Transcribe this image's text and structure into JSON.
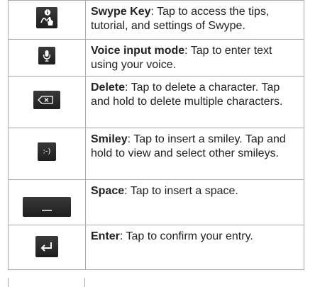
{
  "rows": [
    {
      "icon": "swype-key-icon",
      "term": "Swype Key",
      "desc": ": Tap to access the tips, tutorial, and settings of Swype."
    },
    {
      "icon": "microphone-icon",
      "term": "Voice input mode",
      "desc": ": Tap to enter text using your voice."
    },
    {
      "icon": "backspace-icon",
      "term": "Delete",
      "desc": ": Tap to delete a character. Tap and hold to delete multiple characters."
    },
    {
      "icon": "smiley-key-icon",
      "key_text": ":-)",
      "term": "Smiley",
      "desc": ": Tap to insert a smiley. Tap and hold to view and select other smileys."
    },
    {
      "icon": "space-bar-icon",
      "term": "Space",
      "desc": ": Tap to insert a space."
    },
    {
      "icon": "enter-icon",
      "term": "Enter",
      "desc": ": Tap to confirm your entry."
    }
  ]
}
